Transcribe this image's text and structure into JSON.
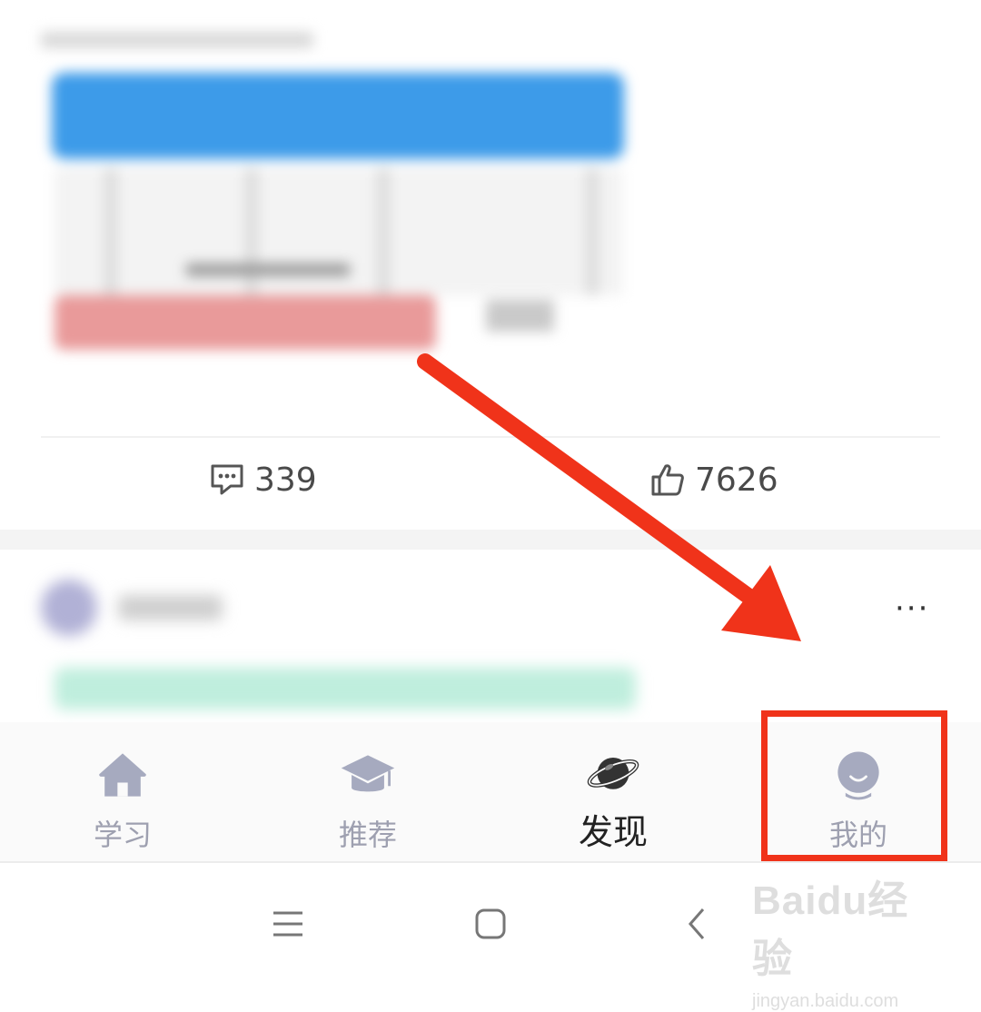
{
  "post": {
    "comment_count": "339",
    "like_count": "7626"
  },
  "tabs": [
    {
      "label": "学习",
      "icon": "home-icon",
      "active": false
    },
    {
      "label": "推荐",
      "icon": "graduation-cap-icon",
      "active": false
    },
    {
      "label": "发现",
      "icon": "planet-icon",
      "active": true
    },
    {
      "label": "我的",
      "icon": "profile-icon",
      "active": false
    }
  ],
  "navbar": {
    "menu_icon": "menu-icon",
    "home_icon": "home-square-icon",
    "back_icon": "back-icon"
  },
  "watermark": {
    "brand": "Baidu经验",
    "url": "jingyan.baidu.com"
  },
  "annotation": {
    "highlight_color": "#f0331a",
    "arrow_color": "#f0331a"
  }
}
